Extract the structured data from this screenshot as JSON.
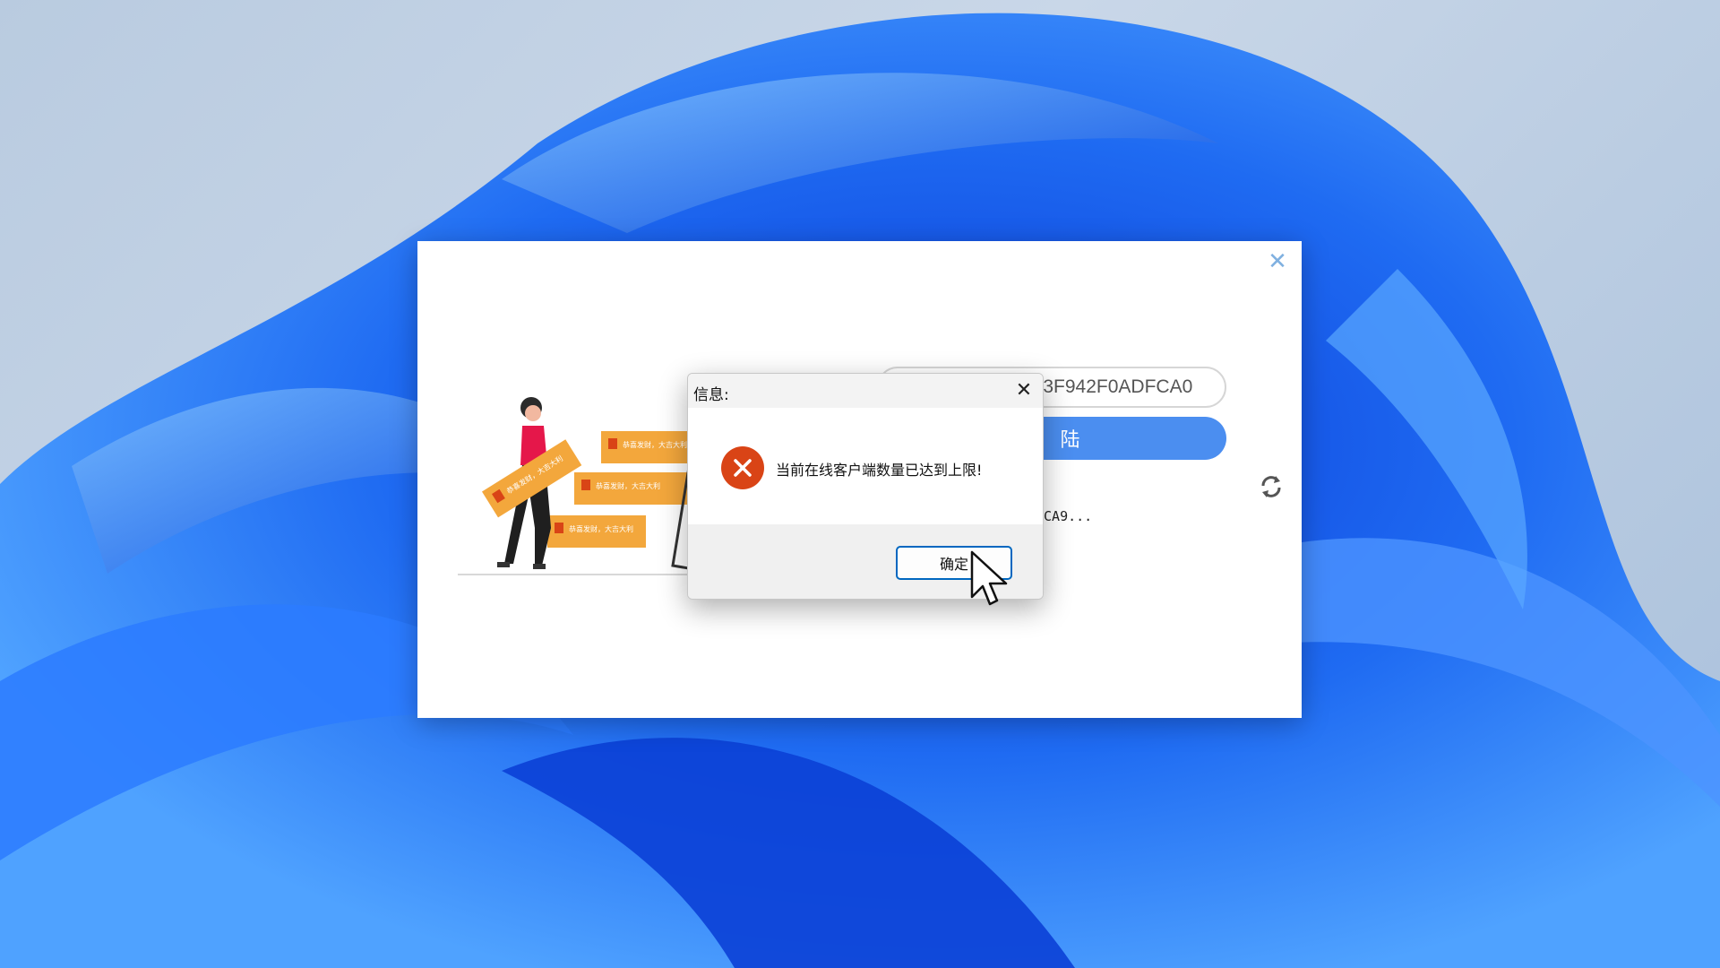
{
  "login_window": {
    "close_glyph": "✕",
    "key_input_value": "503F942F0ADFCA0",
    "login_button_label": "登 陆",
    "machine_code_text": "DCA9...",
    "refresh_icon": "refresh-icon"
  },
  "illustration": {
    "sign_texts": [
      "恭喜发财，大吉大利",
      "恭喜发财，大吉大利",
      "恭喜发财，大吉大利",
      "恭喜发财，大吉大利"
    ]
  },
  "message_dialog": {
    "title": "信息:",
    "close_glyph": "✕",
    "message": "当前在线客户端数量已达到上限!",
    "ok_label": "确定",
    "icon": "error-icon"
  },
  "colors": {
    "primary_blue": "#4b8ef0",
    "error_red": "#d94416",
    "accent_orange": "#f3a73c",
    "focus_border": "#0067c0"
  }
}
